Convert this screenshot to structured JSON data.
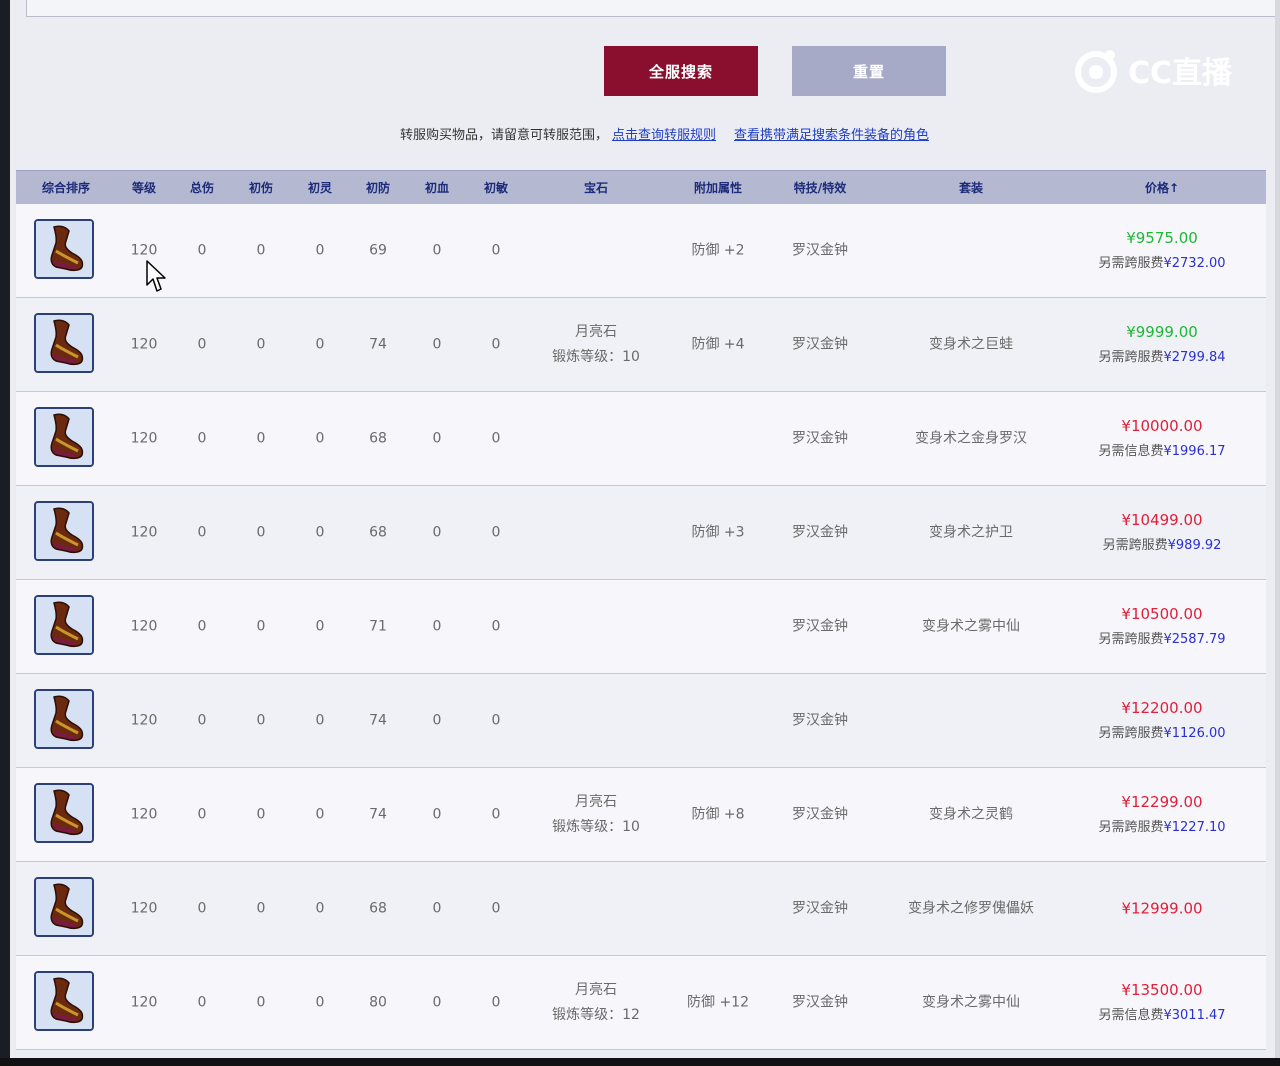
{
  "buttons": {
    "search_label": "全服搜索",
    "reset_label": "重置"
  },
  "notice": {
    "text": "转服购买物品，请留意可转服范围，",
    "link1": "点击查询转服规则",
    "link2": "查看携带满足搜索条件装备的角色"
  },
  "logo": {
    "text": "CC直播"
  },
  "headers": [
    "综合排序",
    "等级",
    "总伤",
    "初伤",
    "初灵",
    "初防",
    "初血",
    "初敏",
    "宝石",
    "附加属性",
    "特技/特效",
    "套装",
    "价格↑"
  ],
  "rows": [
    {
      "level": "120",
      "zongshang": "0",
      "chushang": "0",
      "chuling": "0",
      "chufang": "69",
      "chuxue": "0",
      "chumin": "0",
      "gem1": "",
      "gem2": "",
      "attr": "防御 +2",
      "skill": "罗汉金钟",
      "set": "",
      "price": "¥9575.00",
      "price_color": "green",
      "fee_label": "另需跨服费",
      "fee": "¥2732.00"
    },
    {
      "level": "120",
      "zongshang": "0",
      "chushang": "0",
      "chuling": "0",
      "chufang": "74",
      "chuxue": "0",
      "chumin": "0",
      "gem1": "月亮石",
      "gem2": "锻炼等级：10",
      "attr": "防御 +4",
      "skill": "罗汉金钟",
      "set": "变身术之巨蛙",
      "price": "¥9999.00",
      "price_color": "green",
      "fee_label": "另需跨服费",
      "fee": "¥2799.84"
    },
    {
      "level": "120",
      "zongshang": "0",
      "chushang": "0",
      "chuling": "0",
      "chufang": "68",
      "chuxue": "0",
      "chumin": "0",
      "gem1": "",
      "gem2": "",
      "attr": "",
      "skill": "罗汉金钟",
      "set": "变身术之金身罗汉",
      "price": "¥10000.00",
      "price_color": "red",
      "fee_label": "另需信息费",
      "fee": "¥1996.17"
    },
    {
      "level": "120",
      "zongshang": "0",
      "chushang": "0",
      "chuling": "0",
      "chufang": "68",
      "chuxue": "0",
      "chumin": "0",
      "gem1": "",
      "gem2": "",
      "attr": "防御 +3",
      "skill": "罗汉金钟",
      "set": "变身术之护卫",
      "price": "¥10499.00",
      "price_color": "red",
      "fee_label": "另需跨服费",
      "fee": "¥989.92"
    },
    {
      "level": "120",
      "zongshang": "0",
      "chushang": "0",
      "chuling": "0",
      "chufang": "71",
      "chuxue": "0",
      "chumin": "0",
      "gem1": "",
      "gem2": "",
      "attr": "",
      "skill": "罗汉金钟",
      "set": "变身术之雾中仙",
      "price": "¥10500.00",
      "price_color": "red",
      "fee_label": "另需跨服费",
      "fee": "¥2587.79"
    },
    {
      "level": "120",
      "zongshang": "0",
      "chushang": "0",
      "chuling": "0",
      "chufang": "74",
      "chuxue": "0",
      "chumin": "0",
      "gem1": "",
      "gem2": "",
      "attr": "",
      "skill": "罗汉金钟",
      "set": "",
      "price": "¥12200.00",
      "price_color": "red",
      "fee_label": "另需跨服费",
      "fee": "¥1126.00"
    },
    {
      "level": "120",
      "zongshang": "0",
      "chushang": "0",
      "chuling": "0",
      "chufang": "74",
      "chuxue": "0",
      "chumin": "0",
      "gem1": "月亮石",
      "gem2": "锻炼等级：10",
      "attr": "防御 +8",
      "skill": "罗汉金钟",
      "set": "变身术之灵鹤",
      "price": "¥12299.00",
      "price_color": "red",
      "fee_label": "另需跨服费",
      "fee": "¥1227.10"
    },
    {
      "level": "120",
      "zongshang": "0",
      "chushang": "0",
      "chuling": "0",
      "chufang": "68",
      "chuxue": "0",
      "chumin": "0",
      "gem1": "",
      "gem2": "",
      "attr": "",
      "skill": "罗汉金钟",
      "set": "变身术之修罗傀儡妖",
      "price": "¥12999.00",
      "price_color": "red",
      "fee_label": "",
      "fee": ""
    },
    {
      "level": "120",
      "zongshang": "0",
      "chushang": "0",
      "chuling": "0",
      "chufang": "80",
      "chuxue": "0",
      "chumin": "0",
      "gem1": "月亮石",
      "gem2": "锻炼等级：12",
      "attr": "防御 +12",
      "skill": "罗汉金钟",
      "set": "变身术之雾中仙",
      "price": "¥13500.00",
      "price_color": "red",
      "fee_label": "另需信息费",
      "fee": "¥3011.47"
    }
  ]
}
